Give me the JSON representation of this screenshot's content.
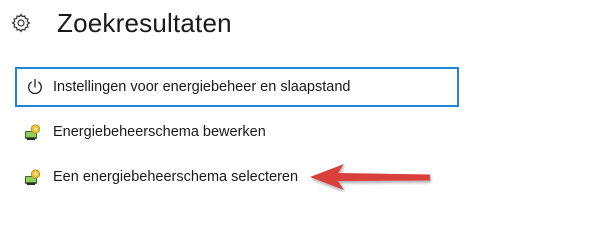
{
  "header": {
    "title": "Zoekresultaten",
    "icon": "gear-icon"
  },
  "results": [
    {
      "label": "Instellingen voor energiebeheer en slaapstand",
      "icon": "power-icon",
      "selected": true
    },
    {
      "label": "Energiebeheerschema bewerken",
      "icon": "power-options-icon",
      "selected": false
    },
    {
      "label": "Een energiebeheerschema selecteren",
      "icon": "power-options-icon",
      "selected": false
    }
  ],
  "colors": {
    "selection_border": "#1f86d6",
    "arrow": "#d9413b"
  }
}
